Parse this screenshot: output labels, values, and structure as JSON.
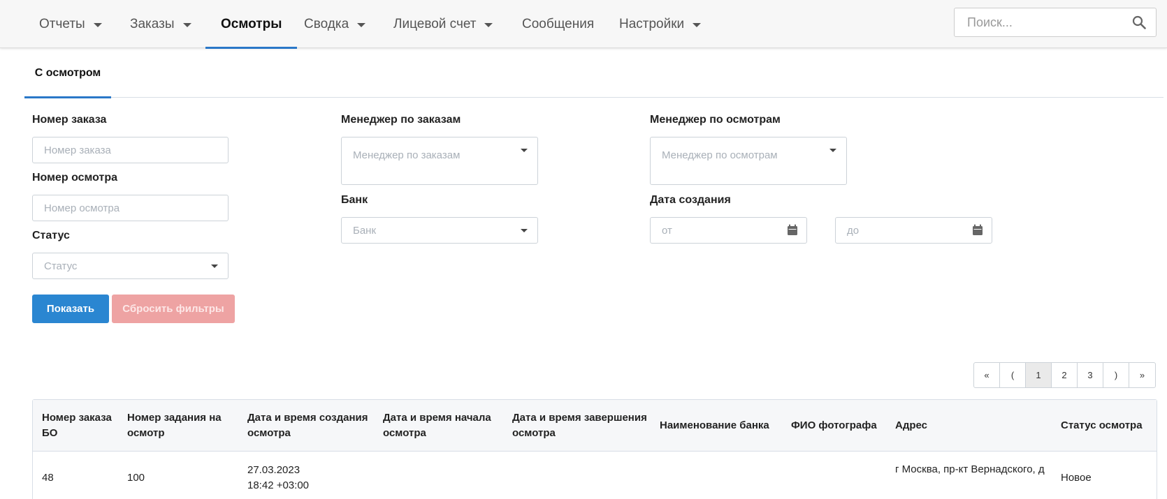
{
  "nav": {
    "items": [
      {
        "label": "Отчеты",
        "dropdown": true,
        "active": false
      },
      {
        "label": "Заказы",
        "dropdown": true,
        "active": false
      },
      {
        "label": "Осмотры",
        "dropdown": false,
        "active": true
      },
      {
        "label": "Сводка",
        "dropdown": true,
        "active": false
      },
      {
        "label": "Лицевой счет",
        "dropdown": true,
        "active": false
      },
      {
        "label": "Сообщения",
        "dropdown": false,
        "active": false
      },
      {
        "label": "Настройки",
        "dropdown": true,
        "active": false
      }
    ],
    "search_placeholder": "Поиск..."
  },
  "subtabs": {
    "active_label": "С осмотром"
  },
  "filters": {
    "order_number": {
      "label": "Номер заказа",
      "placeholder": "Номер заказа"
    },
    "inspection_number": {
      "label": "Номер осмотра",
      "placeholder": "Номер осмотра"
    },
    "status": {
      "label": "Статус",
      "placeholder": "Статус"
    },
    "order_manager": {
      "label": "Менеджер по заказам",
      "placeholder": "Менеджер по заказам"
    },
    "bank": {
      "label": "Банк",
      "placeholder": "Банк"
    },
    "inspection_manager": {
      "label": "Менеджер по осмотрам",
      "placeholder": "Менеджер по осмотрам"
    },
    "created_date": {
      "label": "Дата создания",
      "from_placeholder": "от",
      "to_placeholder": "до"
    },
    "show_label": "Показать",
    "reset_label": "Сбросить фильтры"
  },
  "pagination": {
    "first": "«",
    "prev": "(",
    "pages": [
      "1",
      "2",
      "3"
    ],
    "current": "1",
    "next": ")",
    "last": "»"
  },
  "table": {
    "headers": {
      "order_bo": [
        "Номер заказа",
        "БО"
      ],
      "task": [
        "Номер задания на",
        "осмотр"
      ],
      "created": [
        "Дата и время создания",
        "осмотра"
      ],
      "start": [
        "Дата и время начала",
        "осмотра"
      ],
      "finish": [
        "Дата и время завершения",
        "осмотра"
      ],
      "bank": "Наименование банка",
      "photographer": "ФИО фотографа",
      "address": "Адрес",
      "status": "Статус осмотра"
    },
    "rows": [
      {
        "order_bo": "48",
        "task": "100",
        "created_date": "27.03.2023",
        "created_time": "18:42 +03:00",
        "start": "",
        "finish": "",
        "bank": "",
        "photographer": "",
        "address": "г Москва, пр-кт Вернадского, д",
        "status": "Новое"
      }
    ]
  },
  "colors": {
    "accent": "#2a78c8",
    "primary_button": "#2a86d1",
    "reset_button": "#eea3a3"
  }
}
